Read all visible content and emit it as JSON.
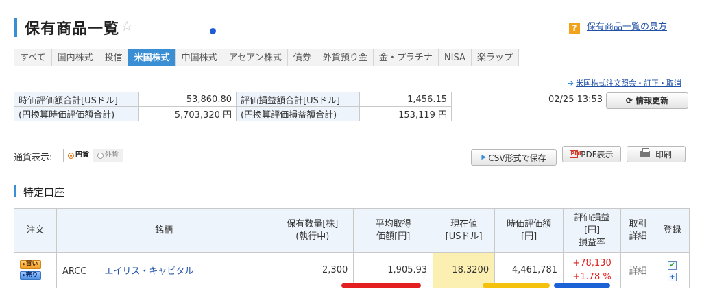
{
  "page": {
    "title": "保有商品一覧",
    "help_link": "保有商品一覧の見方",
    "help_icon": "?"
  },
  "tabs": [
    {
      "label": "すべて",
      "active": false
    },
    {
      "label": "国内株式",
      "active": false
    },
    {
      "label": "投信",
      "active": false
    },
    {
      "label": "米国株式",
      "active": true
    },
    {
      "label": "中国株式",
      "active": false
    },
    {
      "label": "アセアン株式",
      "active": false
    },
    {
      "label": "債券",
      "active": false
    },
    {
      "label": "外貨預り金",
      "active": false
    },
    {
      "label": "金・プラチナ",
      "active": false
    },
    {
      "label": "NISA",
      "active": false
    },
    {
      "label": "楽ラップ",
      "active": false
    }
  ],
  "order_link": "米国株式注文照会・訂正・取消",
  "summary": {
    "row1": {
      "label1": "時価評価額合計[USドル]",
      "value1": "53,860.80",
      "label2": "評価損益額合計[USドル]",
      "value2": "1,456.15"
    },
    "row2": {
      "label1": "(円換算時価評価額合計)",
      "value1": "5,703,320 円",
      "label2": "(円換算評価損益額合計)",
      "value2": "153,119 円"
    }
  },
  "timestamp": "02/25 13:53",
  "refresh_label": "情報更新",
  "currency": {
    "label": "通貨表示:",
    "options": [
      "円貨",
      "外貨"
    ],
    "selected": "円貨"
  },
  "buttons": {
    "csv": "CSV形式で保存",
    "pdf": "PDF表示",
    "print": "印刷"
  },
  "section_title": "特定口座",
  "holdings": {
    "headers": {
      "order": "注文",
      "name": "銘柄",
      "qty_1": "保有数量[株]",
      "qty_2": "(執行中)",
      "avg_1": "平均取得",
      "avg_2": "価額[円]",
      "price_1": "現在値",
      "price_2": "[USドル]",
      "value_1": "時価評価額",
      "value_2": "[円]",
      "pl_1": "評価損益",
      "pl_2": "[円]",
      "pl_3": "損益率",
      "detail_1": "取引",
      "detail_2": "詳細",
      "register": "登録"
    },
    "rows": [
      {
        "buy": "買い",
        "sell": "売り",
        "ticker": "ARCC",
        "name": "エイリス・キャピタル",
        "qty": "2,300",
        "avg_cost": "1,905.93",
        "price": "18.3200",
        "market_value": "4,461,781",
        "pl_amount": "+78,130",
        "pl_rate": "+1.78 %",
        "detail": "詳細",
        "check": "✔",
        "plus": "+"
      }
    ]
  },
  "colors": {
    "accent": "#3a8ed4",
    "profit": "#e02020",
    "highlight": "#fcefb2",
    "mark_red": "#e31f1f",
    "mark_yellow": "#f4c20d",
    "mark_blue": "#1a62d6"
  }
}
